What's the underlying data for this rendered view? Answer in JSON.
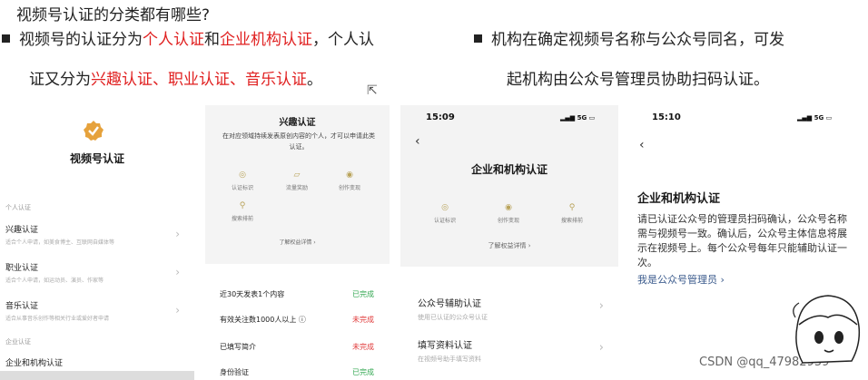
{
  "heading": "视频号认证的分类都有哪些?",
  "bullet1": {
    "a": "视频号的认证分为",
    "b": "个人认证",
    "c": "和",
    "d": "企业机构认证",
    "e": "，个人认",
    "f": "证又分为",
    "g": "兴趣认证、职业认证、音乐认证",
    "h": "。"
  },
  "bullet2": {
    "l1": "机构在确定视频号名称与公众号同名，可发",
    "l2": "起机构由公众号管理员协助扫码认证。"
  },
  "panel1": {
    "title": "视频号认证",
    "section_personal": "个人认证",
    "items": [
      {
        "name": "兴趣认证",
        "desc": "适合个人申请，如美食博主、互联网自媒体等"
      },
      {
        "name": "职业认证",
        "desc": "适合个人申请，如运动员、演员、作家等"
      },
      {
        "name": "音乐认证",
        "desc": "适合从事音乐创作等相关行业或爱好者申请"
      }
    ],
    "section_org": "企业认证",
    "org_item": "企业和机构认证"
  },
  "panel2": {
    "title": "兴趣认证",
    "desc": "在对应领域持续发表原创内容的个人，才可以申请此类认证。",
    "icons": [
      "认证标识",
      "流量奖励",
      "创作变现",
      "搜索排前"
    ],
    "more": "了解权益详情 ›",
    "reqs": [
      {
        "label": "近30天发表1个内容",
        "status": "已完成",
        "ok": true
      },
      {
        "label": "有效关注数1000人以上 ⓘ",
        "status": "未完成",
        "ok": false
      },
      {
        "label": "已填写简介",
        "status": "未完成",
        "ok": false
      },
      {
        "label": "身份验证",
        "status": "已完成",
        "ok": true
      }
    ]
  },
  "panel3": {
    "time": "15:09",
    "signal": "5G",
    "title": "企业和机构认证",
    "icons": [
      "认证标识",
      "创作变现",
      "搜索排前"
    ],
    "more": "了解权益详情 ›",
    "items": [
      {
        "name": "公众号辅助认证",
        "desc": "使用已认证的公众号认证"
      },
      {
        "name": "填写资料认证",
        "desc": "在视频号助手填写资料"
      }
    ]
  },
  "panel4": {
    "time": "15:10",
    "signal": "5G",
    "title": "企业和机构认证",
    "body": "请已认证公众号的管理员扫码确认，公众号名称需与视频号一致。确认后，公众号主体信息将展示在视频号上。每个公众号每年只能辅助认证一次。",
    "link": "我是公众号管理员 ›"
  },
  "watermark": "CSDN @qq_47982959",
  "colors": {
    "red": "#e02020",
    "ok": "#35a853",
    "no": "#e03a3a",
    "link": "#3a5a8c",
    "gold": "#e6a23c"
  }
}
